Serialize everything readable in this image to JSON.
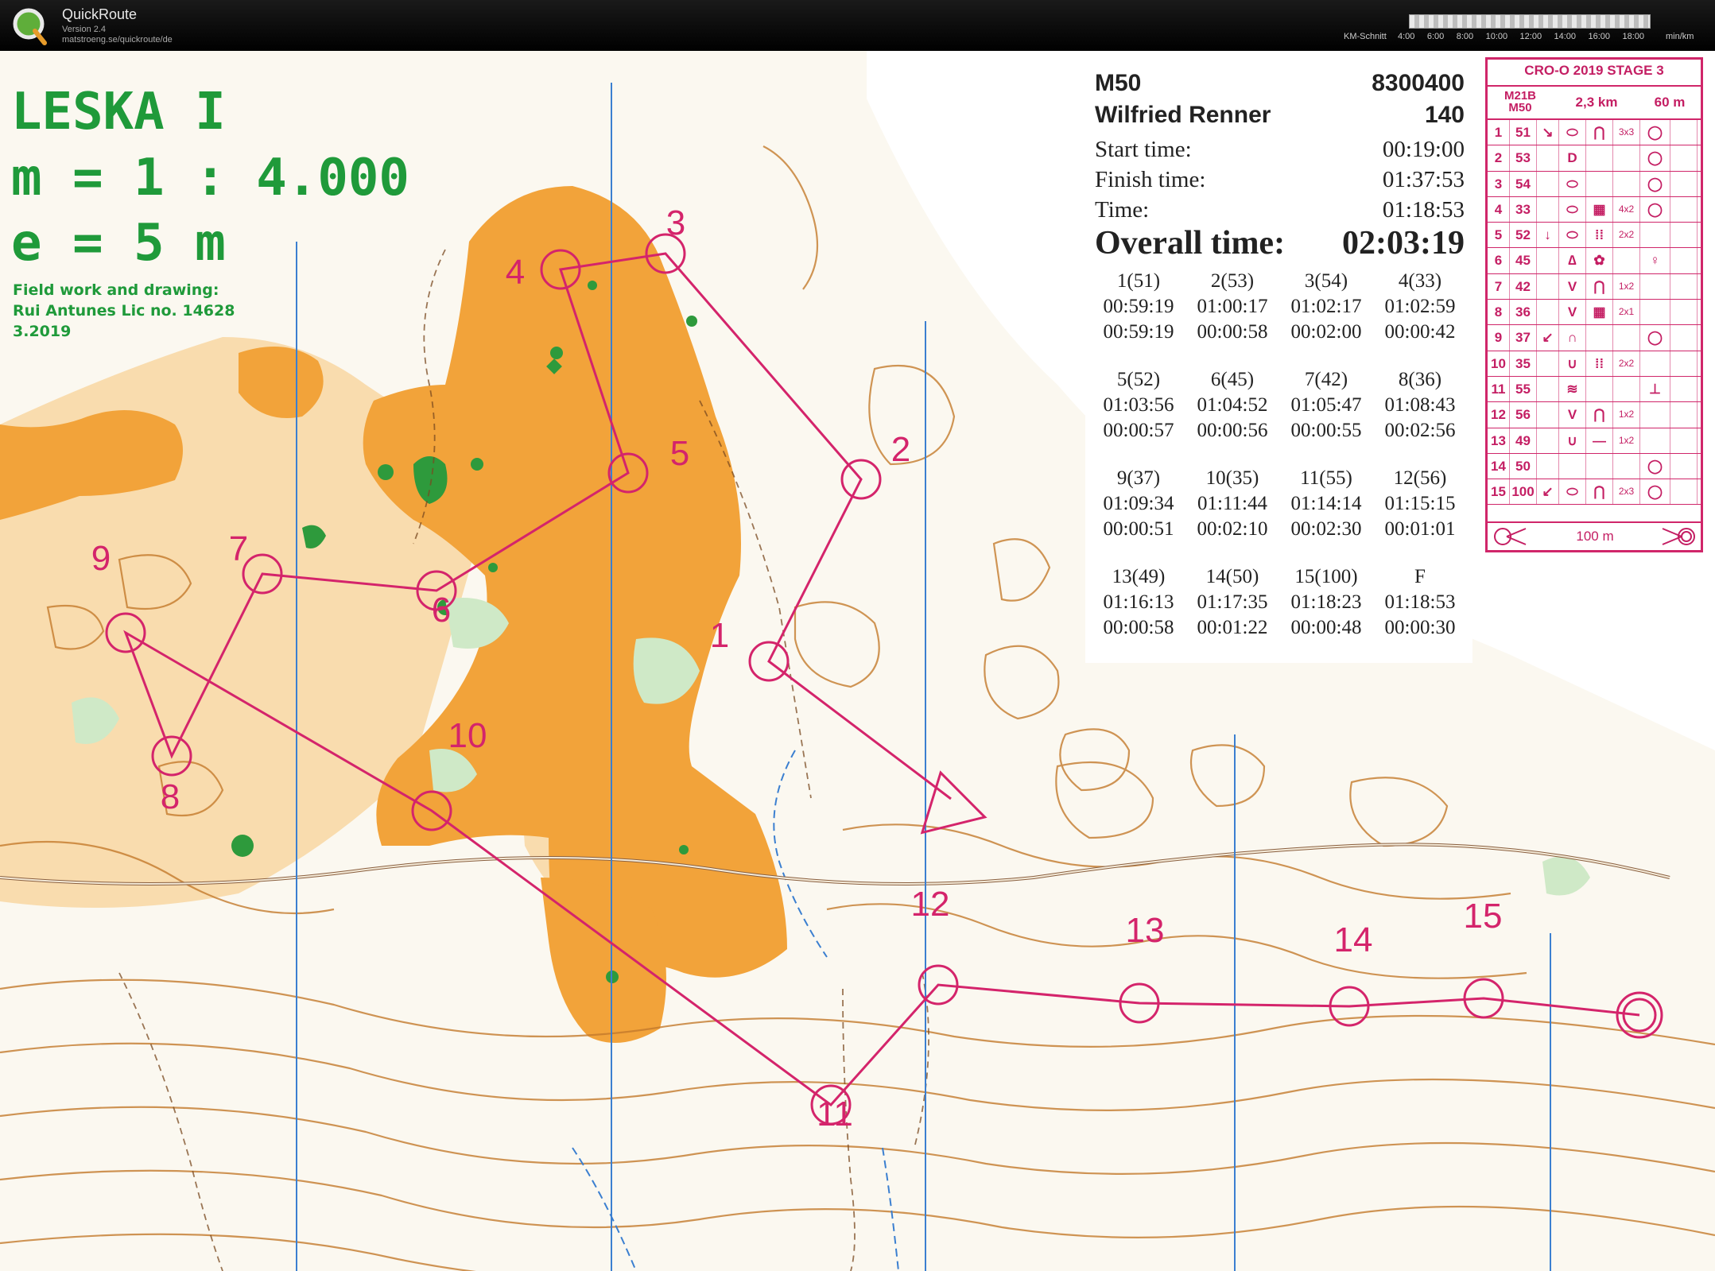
{
  "app": {
    "title": "QuickRoute",
    "version": "Version 2.4",
    "url": "matstroeng.se/quickroute/de",
    "pace_label": "KM-Schnitt",
    "pace_ticks": [
      "4:00",
      "6:00",
      "8:00",
      "10:00",
      "12:00",
      "14:00",
      "16:00",
      "18:00"
    ],
    "pace_unit": "min/km"
  },
  "map_legend": {
    "name": "LESKA I",
    "scale": "m = 1 : 4.000",
    "equidistance": "e = 5 m",
    "credit_line_1": "Field work and drawing:",
    "credit_line_2": "Rui Antunes Lic no. 14628",
    "credit_line_3": "3.2019"
  },
  "result": {
    "class": "M50",
    "id": "8300400",
    "name": "Wilfried Renner",
    "bib": "140",
    "start_label": "Start time:",
    "start_time": "00:19:00",
    "finish_label": "Finish time:",
    "finish_time": "01:37:53",
    "time_label": "Time:",
    "time": "01:18:53",
    "overall_label": "Overall time:",
    "overall_time": "02:03:19",
    "splits": [
      {
        "control": "1(51)",
        "cumulative": "00:59:19",
        "split": "00:59:19"
      },
      {
        "control": "2(53)",
        "cumulative": "01:00:17",
        "split": "00:00:58"
      },
      {
        "control": "3(54)",
        "cumulative": "01:02:17",
        "split": "00:02:00"
      },
      {
        "control": "4(33)",
        "cumulative": "01:02:59",
        "split": "00:00:42"
      },
      {
        "control": "5(52)",
        "cumulative": "01:03:56",
        "split": "00:00:57"
      },
      {
        "control": "6(45)",
        "cumulative": "01:04:52",
        "split": "00:00:56"
      },
      {
        "control": "7(42)",
        "cumulative": "01:05:47",
        "split": "00:00:55"
      },
      {
        "control": "8(36)",
        "cumulative": "01:08:43",
        "split": "00:02:56"
      },
      {
        "control": "9(37)",
        "cumulative": "01:09:34",
        "split": "00:00:51"
      },
      {
        "control": "10(35)",
        "cumulative": "01:11:44",
        "split": "00:02:10"
      },
      {
        "control": "11(55)",
        "cumulative": "01:14:14",
        "split": "00:02:30"
      },
      {
        "control": "12(56)",
        "cumulative": "01:15:15",
        "split": "00:01:01"
      },
      {
        "control": "13(49)",
        "cumulative": "01:16:13",
        "split": "00:00:58"
      },
      {
        "control": "14(50)",
        "cumulative": "01:17:35",
        "split": "00:01:22"
      },
      {
        "control": "15(100)",
        "cumulative": "01:18:23",
        "split": "00:00:48"
      },
      {
        "control": "F",
        "cumulative": "01:18:53",
        "split": "00:00:30"
      }
    ]
  },
  "control_description": {
    "title": "CRO-O 2019 STAGE 3",
    "class_line_1": "M21B",
    "class_line_2": "M50",
    "distance": "2,3 km",
    "climb": "60 m",
    "rows": [
      {
        "n": "1",
        "code": "51",
        "c": "↘",
        "d": "⬭",
        "e": "⋂",
        "f": "3x3",
        "g": "◯"
      },
      {
        "n": "2",
        "code": "53",
        "c": "",
        "d": "D",
        "e": "",
        "f": "",
        "g": "◯"
      },
      {
        "n": "3",
        "code": "54",
        "c": "",
        "d": "⬭",
        "e": "",
        "f": "",
        "g": "◯"
      },
      {
        "n": "4",
        "code": "33",
        "c": "",
        "d": "⬭",
        "e": "▦",
        "f": "4x2",
        "g": "◯"
      },
      {
        "n": "5",
        "code": "52",
        "c": "↓",
        "d": "⬭",
        "e": "⁞⁞",
        "f": "2x2",
        "g": ""
      },
      {
        "n": "6",
        "code": "45",
        "c": "",
        "d": "∆",
        "e": "✿",
        "f": "",
        "g": "♀"
      },
      {
        "n": "7",
        "code": "42",
        "c": "",
        "d": "V",
        "e": "⋂",
        "f": "1x2",
        "g": ""
      },
      {
        "n": "8",
        "code": "36",
        "c": "",
        "d": "V",
        "e": "▦",
        "f": "2x1",
        "g": ""
      },
      {
        "n": "9",
        "code": "37",
        "c": "↙",
        "d": "∩",
        "e": "",
        "f": "",
        "g": "◯"
      },
      {
        "n": "10",
        "code": "35",
        "c": "",
        "d": "∪",
        "e": "⁞⁞",
        "f": "2x2",
        "g": ""
      },
      {
        "n": "11",
        "code": "55",
        "c": "",
        "d": "≋",
        "e": "",
        "f": "",
        "g": "⊥"
      },
      {
        "n": "12",
        "code": "56",
        "c": "",
        "d": "V",
        "e": "⋂",
        "f": "1x2",
        "g": ""
      },
      {
        "n": "13",
        "code": "49",
        "c": "",
        "d": "∪",
        "e": "—",
        "f": "1x2",
        "g": ""
      },
      {
        "n": "14",
        "code": "50",
        "c": "",
        "d": "",
        "e": "",
        "f": "",
        "g": "◯"
      },
      {
        "n": "15",
        "code": "100",
        "c": "↙",
        "d": "⬭",
        "e": "⋂",
        "f": "2x3",
        "g": "◯"
      }
    ],
    "footer_distance": "100 m"
  },
  "course": {
    "controls": [
      {
        "label": "1"
      },
      {
        "label": "2"
      },
      {
        "label": "3"
      },
      {
        "label": "4"
      },
      {
        "label": "5"
      },
      {
        "label": "6"
      },
      {
        "label": "7"
      },
      {
        "label": "8"
      },
      {
        "label": "9"
      },
      {
        "label": "10"
      },
      {
        "label": "11"
      },
      {
        "label": "12"
      },
      {
        "label": "13"
      },
      {
        "label": "14"
      },
      {
        "label": "15"
      }
    ],
    "course_color": "#d4246b"
  },
  "colors": {
    "forest_orange": "#f2a33a",
    "light_orange": "#f9d9a6",
    "green": "#2e9a3c",
    "contour_brown": "#c47a2c",
    "north_line_blue": "#3b7fd0"
  }
}
